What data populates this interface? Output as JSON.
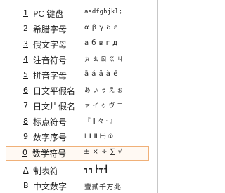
{
  "menu": {
    "items": [
      {
        "key": "1",
        "label": "PC 键盘",
        "preview": "asdfghjkl;"
      },
      {
        "key": "2",
        "label": "希腊字母",
        "preview": "α β γ δ ε"
      },
      {
        "key": "3",
        "label": "俄文字母",
        "preview": "а б в г д"
      },
      {
        "key": "4",
        "label": "注音符号",
        "preview": "ㄆ ㄠ ㄖ ㄍ ㄐ"
      },
      {
        "key": "5",
        "label": "拼音字母",
        "preview": "ā á ǎ à ē"
      },
      {
        "key": "6",
        "label": "日文平假名",
        "preview": "あ ぃ ぅ え ぉ"
      },
      {
        "key": "7",
        "label": "日文片假名",
        "preview": "ァ イ ゥ ヴ エ"
      },
      {
        "key": "8",
        "label": "标点符号",
        "preview": "『 ‖ 々 · 』"
      },
      {
        "key": "9",
        "label": "数字序号",
        "preview": "Ⅰ Ⅱ Ⅲ ㈠ ①"
      },
      {
        "key": "0",
        "label": "数学符号",
        "preview": "± × ÷ ∑ √"
      },
      {
        "key": "A",
        "label": "制表符",
        "preview": "┓┓┣┳┫"
      },
      {
        "key": "B",
        "label": "中文数字",
        "preview": "壹贰千万兆"
      }
    ],
    "selected_index": 9,
    "selected_border_color": "#f0b078"
  }
}
